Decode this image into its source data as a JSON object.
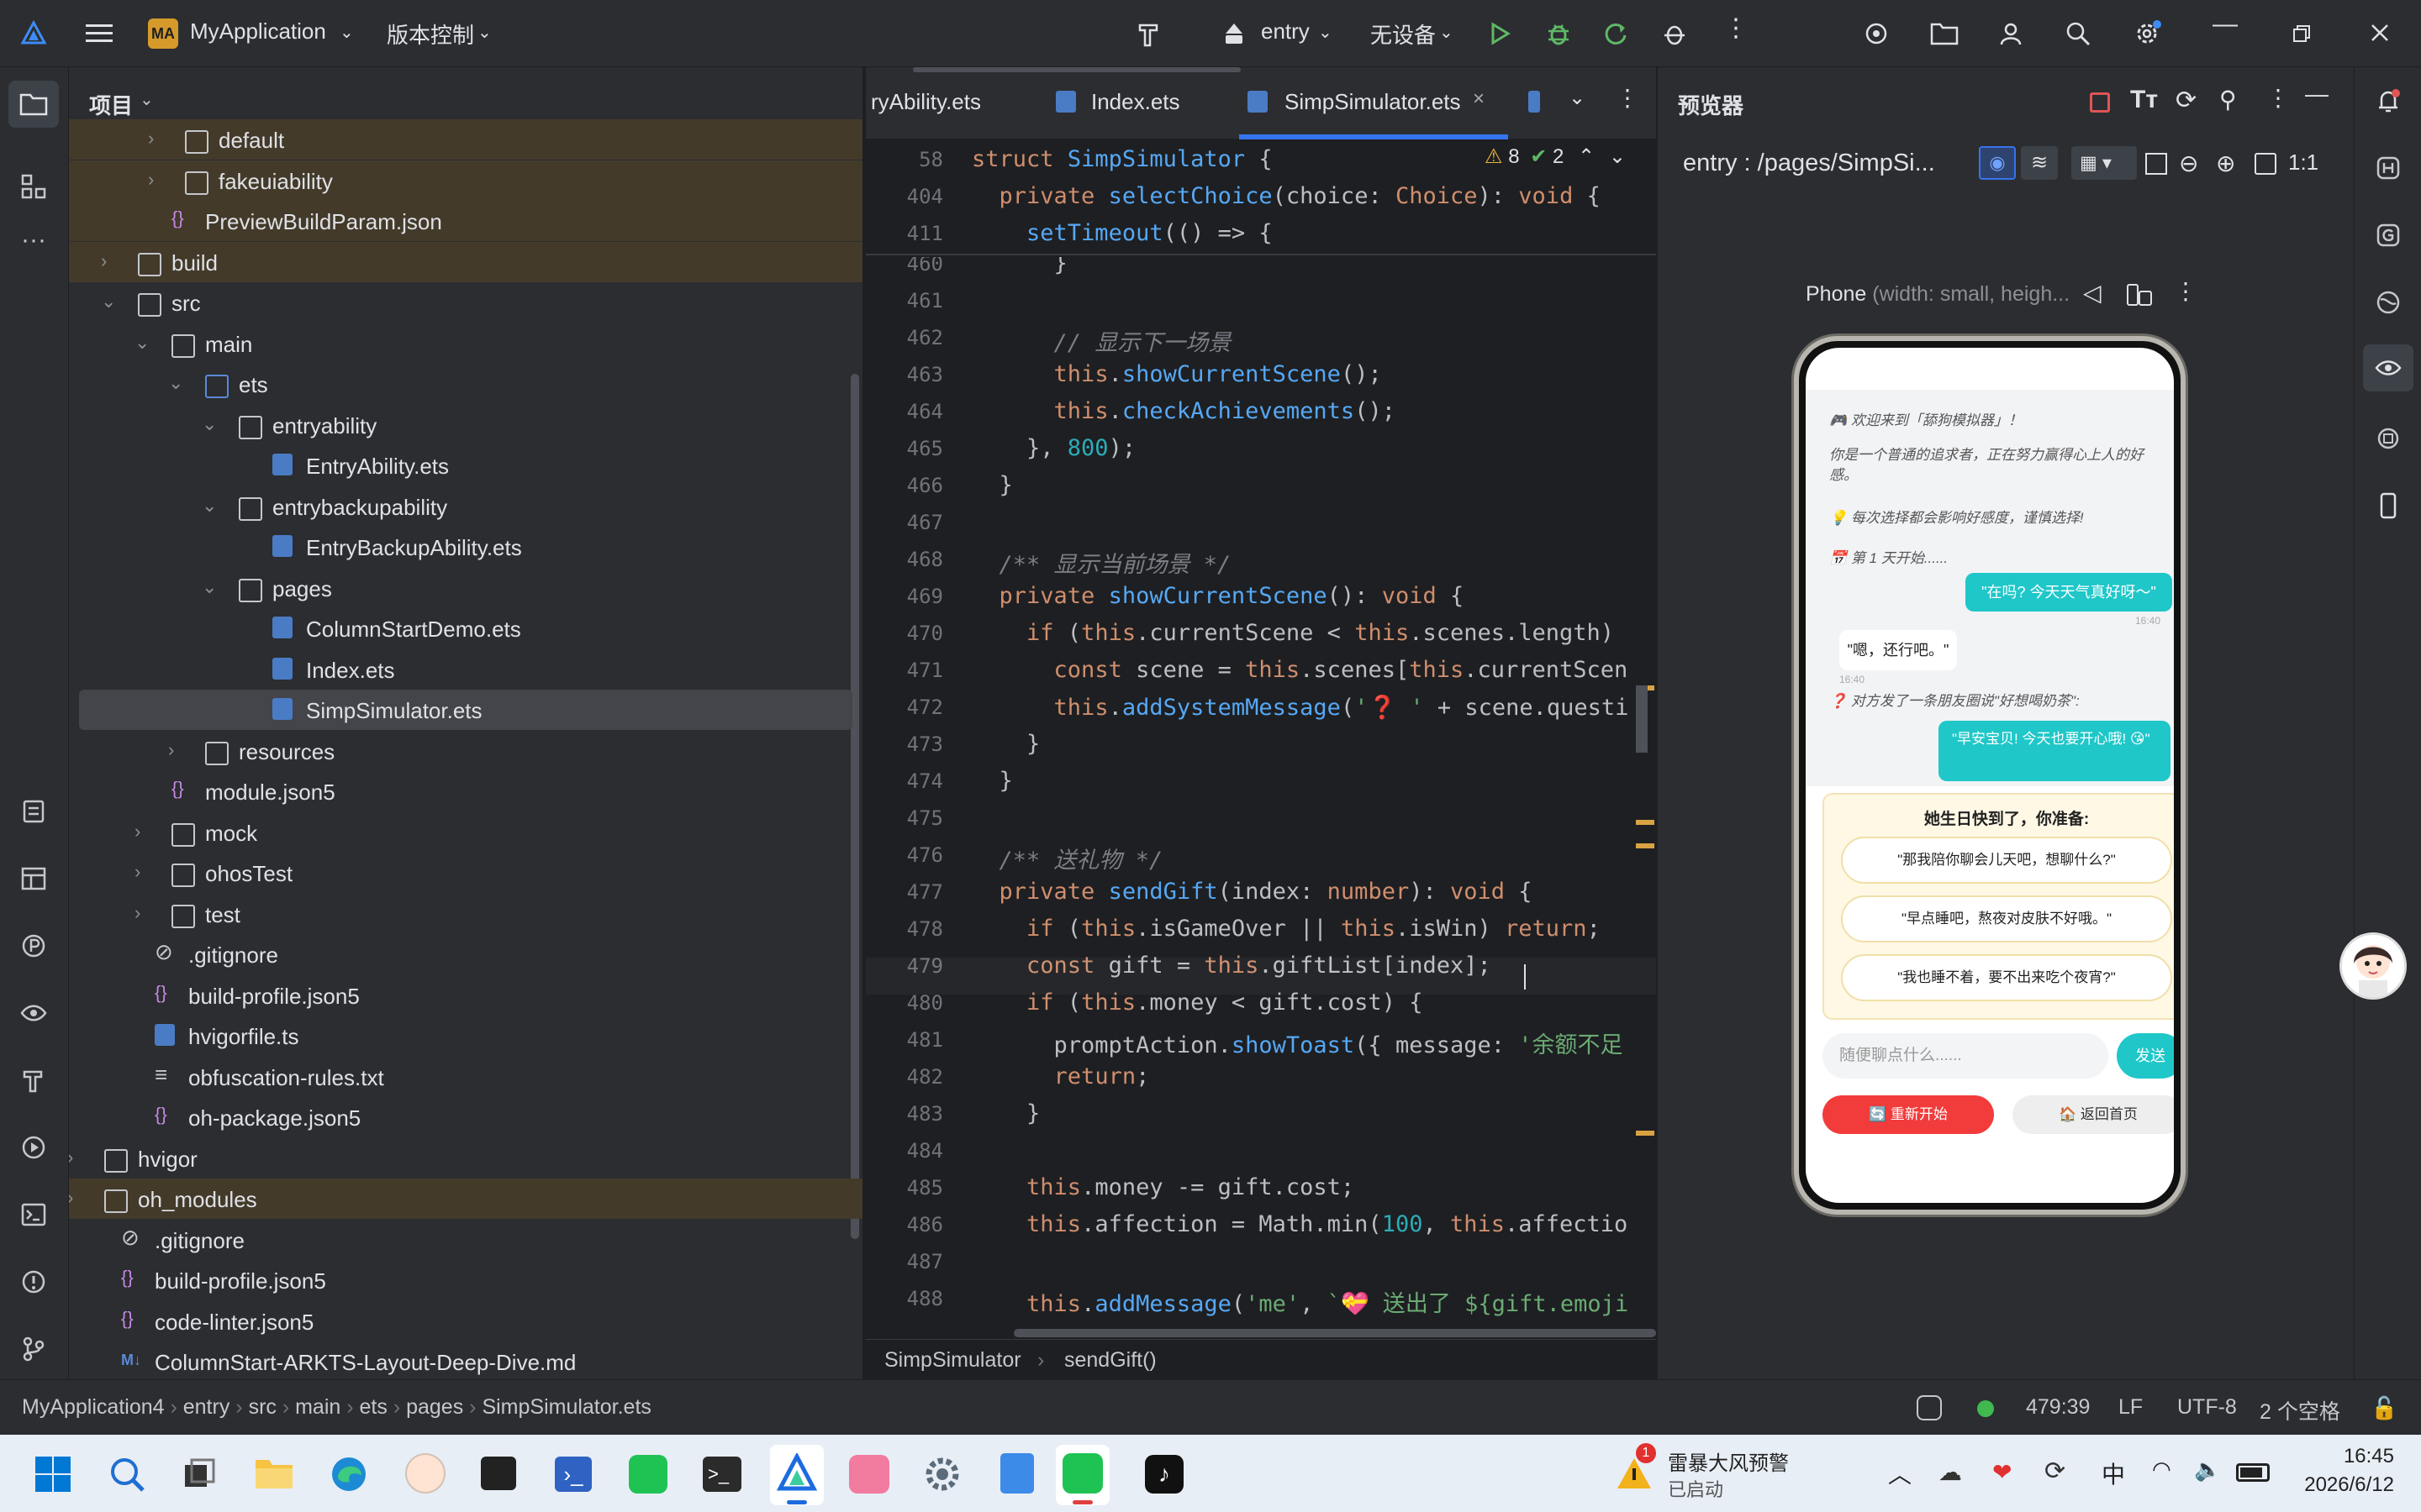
{
  "titlebar": {
    "project_badge": "MA",
    "project_name": "MyApplication",
    "vcs_menu": "版本控制",
    "run_config": "entry",
    "device": "无设备"
  },
  "project_panel": {
    "title": "项目",
    "tree": [
      {
        "label": "default",
        "type": "folder"
      },
      {
        "label": "fakeuiability",
        "type": "folder"
      },
      {
        "label": "PreviewBuildParam.json",
        "type": "json"
      },
      {
        "label": "build",
        "type": "folder"
      },
      {
        "label": "src",
        "type": "folder"
      },
      {
        "label": "main",
        "type": "folder"
      },
      {
        "label": "ets",
        "type": "folder"
      },
      {
        "label": "entryability",
        "type": "folder"
      },
      {
        "label": "EntryAbility.ets",
        "type": "ets"
      },
      {
        "label": "entrybackupability",
        "type": "folder"
      },
      {
        "label": "EntryBackupAbility.ets",
        "type": "ets"
      },
      {
        "label": "pages",
        "type": "folder"
      },
      {
        "label": "ColumnStartDemo.ets",
        "type": "ets"
      },
      {
        "label": "Index.ets",
        "type": "ets"
      },
      {
        "label": "SimpSimulator.ets",
        "type": "ets"
      },
      {
        "label": "resources",
        "type": "folder"
      },
      {
        "label": "module.json5",
        "type": "json"
      },
      {
        "label": "mock",
        "type": "folder"
      },
      {
        "label": "ohosTest",
        "type": "folder"
      },
      {
        "label": "test",
        "type": "folder"
      },
      {
        "label": ".gitignore",
        "type": "ignore"
      },
      {
        "label": "build-profile.json5",
        "type": "json"
      },
      {
        "label": "hvigorfile.ts",
        "type": "ets"
      },
      {
        "label": "obfuscation-rules.txt",
        "type": "txt"
      },
      {
        "label": "oh-package.json5",
        "type": "json"
      },
      {
        "label": "hvigor",
        "type": "folder"
      },
      {
        "label": "oh_modules",
        "type": "folder"
      },
      {
        "label": ".gitignore",
        "type": "ignore"
      },
      {
        "label": "build-profile.json5",
        "type": "json"
      },
      {
        "label": "code-linter.json5",
        "type": "json"
      },
      {
        "label": "ColumnStart-ARKTS-Layout-Deep-Dive.md",
        "type": "md"
      }
    ]
  },
  "editor": {
    "tabs": [
      "ryAbility.ets",
      "Index.ets",
      "SimpSimulator.ets"
    ],
    "warnings": "8",
    "checks": "2",
    "sticky": [
      {
        "ln": "58",
        "code": "struct SimpSimulator {"
      },
      {
        "ln": "404",
        "code": "  private selectChoice(choice: Choice): void {"
      },
      {
        "ln": "411",
        "code": "    setTimeout(() => {"
      }
    ],
    "lines": [
      {
        "ln": "460",
        "code": "      }"
      },
      {
        "ln": "461",
        "code": ""
      },
      {
        "ln": "462",
        "code": "      // 显示下一场景"
      },
      {
        "ln": "463",
        "code": "      this.showCurrentScene();"
      },
      {
        "ln": "464",
        "code": "      this.checkAchievements();"
      },
      {
        "ln": "465",
        "code": "    }, 800);"
      },
      {
        "ln": "466",
        "code": "  }"
      },
      {
        "ln": "467",
        "code": ""
      },
      {
        "ln": "468",
        "code": "  /** 显示当前场景 */"
      },
      {
        "ln": "469",
        "code": "  private showCurrentScene(): void {"
      },
      {
        "ln": "470",
        "code": "    if (this.currentScene < this.scenes.length)"
      },
      {
        "ln": "471",
        "code": "      const scene = this.scenes[this.currentScen"
      },
      {
        "ln": "472",
        "code": "      this.addSystemMessage('❓ ' + scene.questi"
      },
      {
        "ln": "473",
        "code": "    }"
      },
      {
        "ln": "474",
        "code": "  }"
      },
      {
        "ln": "475",
        "code": ""
      },
      {
        "ln": "476",
        "code": "  /** 送礼物 */"
      },
      {
        "ln": "477",
        "code": "  private sendGift(index: number): void {"
      },
      {
        "ln": "478",
        "code": "    if (this.isGameOver || this.isWin) return;"
      },
      {
        "ln": "479",
        "code": "    const gift = this.giftList[index];"
      },
      {
        "ln": "480",
        "code": "    if (this.money < gift.cost) {"
      },
      {
        "ln": "481",
        "code": "      promptAction.showToast({ message: '余额不足"
      },
      {
        "ln": "482",
        "code": "      return;"
      },
      {
        "ln": "483",
        "code": "    }"
      },
      {
        "ln": "484",
        "code": ""
      },
      {
        "ln": "485",
        "code": "    this.money -= gift.cost;"
      },
      {
        "ln": "486",
        "code": "    this.affection = Math.min(100, this.affectio"
      },
      {
        "ln": "487",
        "code": ""
      },
      {
        "ln": "488",
        "code": "    this.addMessage('me', `💝 送出了 ${gift.emoji"
      }
    ],
    "breadcrumb": [
      "SimpSimulator",
      "sendGift()"
    ]
  },
  "preview": {
    "title": "预览器",
    "route": "entry : /pages/SimpSi...",
    "device_label": "Phone",
    "device_desc": "(width: small, heigh...",
    "chat": {
      "sys1": "🎮 欢迎来到「舔狗模拟器」！",
      "sys2": "你是一个普通的追求者，正在努力赢得心上人的好感。",
      "sys3": "💡 每次选择都会影响好感度，谨慎选择!",
      "sys4": "📅 第 1 天开始......",
      "me1": "\"在吗? 今天天气真好呀～\"",
      "me1_time": "16:40",
      "her1": "\"嗯，还行吧。\"",
      "her1_time": "16:40",
      "sys5": "❓ 对方发了一条朋友圈说\"好想喝奶茶\":",
      "me2": "\"早安宝贝! 今天也要开心哦! 😘\"",
      "choice_title": "她生日快到了，你准备:",
      "choices": [
        "\"那我陪你聊会儿天吧，想聊什么?\"",
        "\"早点睡吧，熬夜对皮肤不好哦。\"",
        "\"我也睡不着，要不出来吃个夜宵?\""
      ],
      "input_placeholder": "随便聊点什么......",
      "send": "发送",
      "restart": "🔄 重新开始",
      "home": "🏠 返回首页"
    }
  },
  "statusbar": {
    "path": [
      "MyApplication4",
      "entry",
      "src",
      "main",
      "ets",
      "pages",
      "SimpSimulator.ets"
    ],
    "cursor": "479:39",
    "line_sep": "LF",
    "encoding": "UTF-8",
    "indent": "2 个空格"
  },
  "taskbar": {
    "weather_title": "雷暴大风预警",
    "weather_sub": "已启动",
    "weather_badge": "1",
    "ime": "中",
    "time": "16:45",
    "date": "2026/6/12"
  },
  "colors": {
    "accent": "#3574f0",
    "ide_bg": "#1e1f22",
    "panel_bg": "#2b2d30",
    "chat_me": "#1fc7c9",
    "restart": "#f23b3b"
  }
}
